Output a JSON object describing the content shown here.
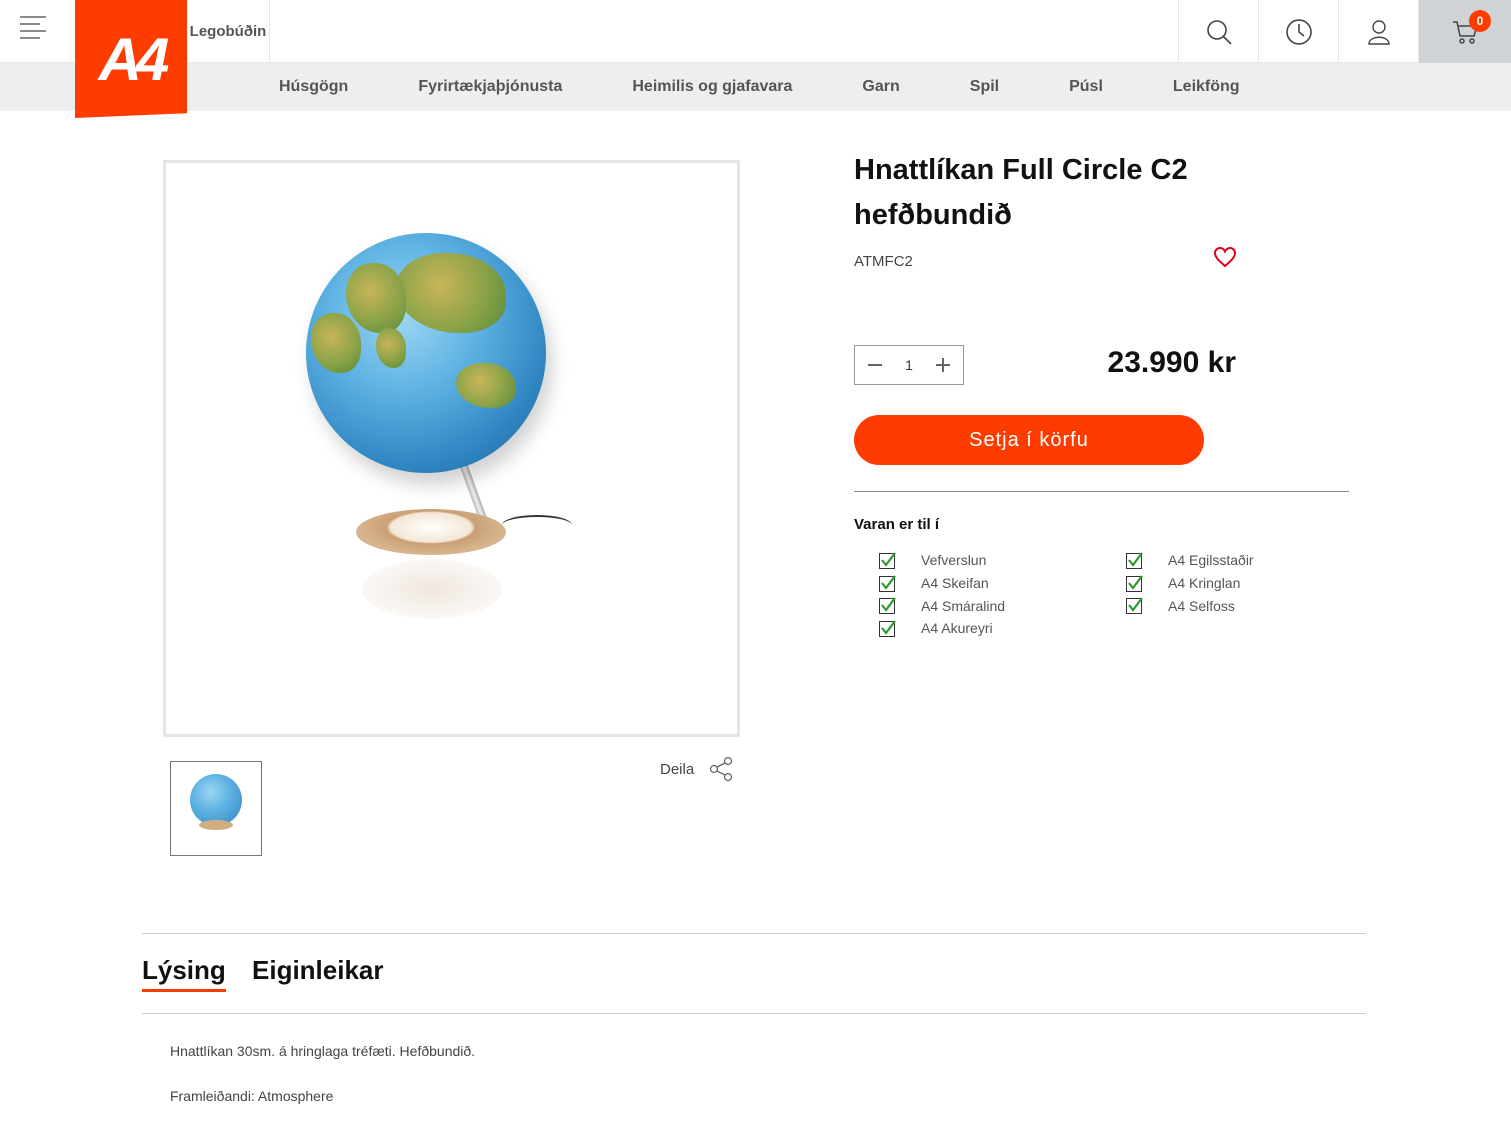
{
  "header": {
    "logo_text": "A4",
    "store_name": "Legobúðin",
    "cart_count": "0",
    "brand_color": "#ff3c00",
    "icons": [
      "menu-icon",
      "search-icon",
      "clock-icon",
      "user-icon",
      "cart-icon"
    ]
  },
  "nav": {
    "items": [
      "Húsgögn",
      "Fyrirtækjaþjónusta",
      "Heimilis og gjafavara",
      "Garn",
      "Spil",
      "Púsl",
      "Leikföng"
    ]
  },
  "product": {
    "title": "Hnattlíkan Full Circle C2 hefðbundið",
    "sku": "ATMFC2",
    "quantity": "1",
    "price": "23.990 kr",
    "add_to_cart": "Setja í körfu",
    "share_label": "Deila"
  },
  "availability": {
    "heading": "Varan er til í",
    "left": [
      "Vefverslun",
      "A4 Skeifan",
      "A4 Smáralind",
      "A4 Akureyri"
    ],
    "right": [
      "A4 Egilsstaðir",
      "A4 Kringlan",
      "A4 Selfoss"
    ]
  },
  "tabs": {
    "description": "Lýsing",
    "properties": "Eiginleikar"
  },
  "description": {
    "line1": "Hnattlíkan 30sm. á hringlaga tréfæti. Hefðbundið.",
    "line2": "Framleiðandi: Atmosphere"
  }
}
